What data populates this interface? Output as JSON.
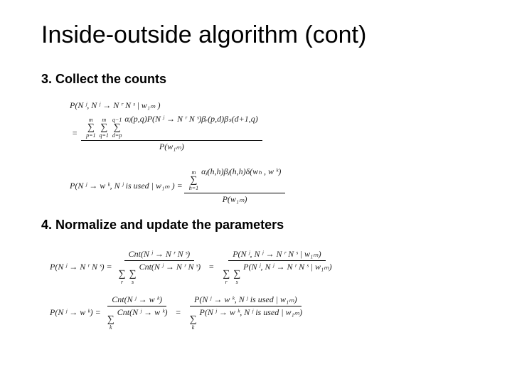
{
  "title": "Inside-outside algorithm (cont)",
  "steps": {
    "s3": "3. Collect the counts",
    "s4": "4. Normalize and update the parameters"
  },
  "eq1": {
    "lhs": "P(N ʲ, N ʲ → N ʳ N ˢ | w₁ₘ )",
    "sum1_top": "m",
    "sum1_bot": "p=1",
    "sum2_top": "m",
    "sum2_bot": "q=1",
    "sum3_top": "q−1",
    "sum3_bot": "d=p",
    "body": "αⱼ(p,q)P(N ʲ → N ʳ N ˢ)βᵣ(p,d)βₛ(d+1,q)",
    "den": "P(w₁ₘ)"
  },
  "eq2": {
    "lhs": "P(N ʲ → w ᵏ, N ʲ is used | w₁ₘ ) =",
    "sum_top": "m",
    "sum_bot": "h=1",
    "body": "αⱼ(h,h)βⱼ(h,h)δ(wₕ , w ᵏ)",
    "den": "P(w₁ₘ)"
  },
  "eq3": {
    "lhs": "P(N ʲ → N ʳ N ˢ) =",
    "num1": "Cnt(N ʲ → N ʳ N ˢ)",
    "den1_sumvars": [
      "r",
      "s"
    ],
    "den1_body": "Cnt(N ʲ → N ʳ N ˢ)",
    "num2": "P(N ʲ, N ʲ → N ʳ N ˢ | w₁ₘ)",
    "den2_body": "P(N ʲ, N ʲ → N ʳ N ˢ | w₁ₘ)"
  },
  "eq4": {
    "lhs": "P(N ʲ → w ᵏ) =",
    "num1": "Cnt(N ʲ → w ᵏ)",
    "den1_sumvar": "k",
    "den1_body": "Cnt(N ʲ → w ᵏ)",
    "num2": "P(N ʲ → w ᵏ, N ʲ is used | w₁ₘ)",
    "den2_body": "P(N ʲ → w ᵏ, N ʲ is used | w₁ₘ)"
  }
}
